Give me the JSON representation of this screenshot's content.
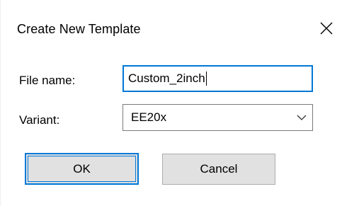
{
  "dialog": {
    "title": "Create New Template",
    "close_icon": "close-icon"
  },
  "form": {
    "file_name_label": "File name:",
    "file_name_value": "Custom_2inch",
    "variant_label": "Variant:",
    "variant_value": "EE20x",
    "variant_icon": "chevron-down-icon"
  },
  "buttons": {
    "ok_label": "OK",
    "cancel_label": "Cancel"
  },
  "colors": {
    "focus_accent": "#0078d7",
    "button_face": "#e1e1e1",
    "border_gray": "#7a7a7a"
  }
}
